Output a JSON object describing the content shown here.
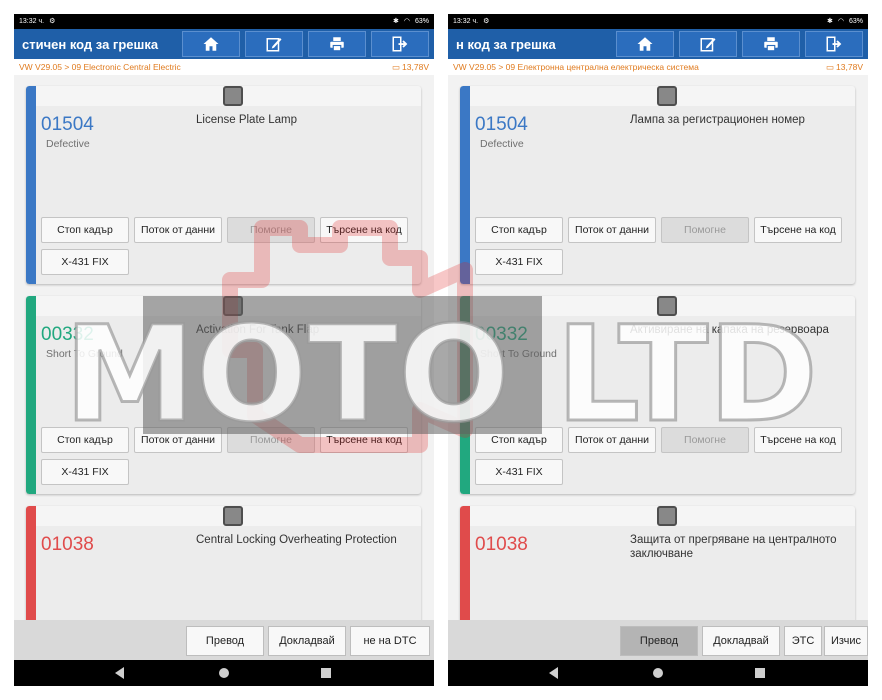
{
  "colors": {
    "header": "#1f5fa8",
    "breadcrumb": "#e07b1f",
    "blue": "#3b78c5",
    "green": "#21a87f",
    "red": "#e04b4b",
    "watermark_red": "#e02020"
  },
  "watermark": {
    "text": "MOTO LTD"
  },
  "screens": [
    {
      "status": {
        "time": "13:32 ч.",
        "battery": "63%"
      },
      "header": {
        "title": "стичен код за грешка",
        "icons": [
          "home-icon",
          "edit-icon",
          "print-icon",
          "exit-icon"
        ]
      },
      "breadcrumb": {
        "path": "VW V29.05 > 09 Electronic Central Electric",
        "voltage": "13,78V"
      },
      "cards": [
        {
          "code": "01504",
          "status": "Defective",
          "desc": "License Plate Lamp",
          "color": "blue",
          "buttons": [
            "Стоп кадър",
            "Поток от данни",
            "Помогне",
            "Търсене на код"
          ],
          "fix": "X-431 FIX"
        },
        {
          "code": "00332",
          "status": "Short To Ground",
          "desc": "Activation For Tank Flap",
          "color": "green",
          "buttons": [
            "Стоп кадър",
            "Поток от данни",
            "Помогне",
            "Търсене на код"
          ],
          "fix": "X-431 FIX"
        },
        {
          "code": "01038",
          "status": "",
          "desc": "Central Locking Overheating Protection",
          "color": "red"
        }
      ],
      "bottom": [
        "Превод",
        "Докладвай",
        "не на DTC"
      ]
    },
    {
      "status": {
        "time": "13:32 ч.",
        "battery": "63%"
      },
      "header": {
        "title": "н код за грешка",
        "icons": [
          "home-icon",
          "edit-icon",
          "print-icon",
          "exit-icon"
        ]
      },
      "breadcrumb": {
        "path": "VW V29.05 > 09 Електронна централна електрическа система",
        "voltage": "13,78V"
      },
      "cards": [
        {
          "code": "01504",
          "status": "Defective",
          "desc": "Лампа за регистрационен номер",
          "color": "blue",
          "buttons": [
            "Стоп кадър",
            "Поток от данни",
            "Помогне",
            "Търсене на код"
          ],
          "fix": "X-431 FIX"
        },
        {
          "code": "00332",
          "status": "Short To Ground",
          "desc": "Активиране на капака на резервоара",
          "color": "green",
          "buttons": [
            "Стоп кадър",
            "Поток от данни",
            "Помогне",
            "Търсене на код"
          ],
          "fix": "X-431 FIX"
        },
        {
          "code": "01038",
          "status": "",
          "desc": "Защита от прегряване на централното заключване",
          "color": "red"
        }
      ],
      "bottom": [
        "Превод",
        "Докладвай",
        "ЭТС",
        "Изчис"
      ]
    }
  ]
}
